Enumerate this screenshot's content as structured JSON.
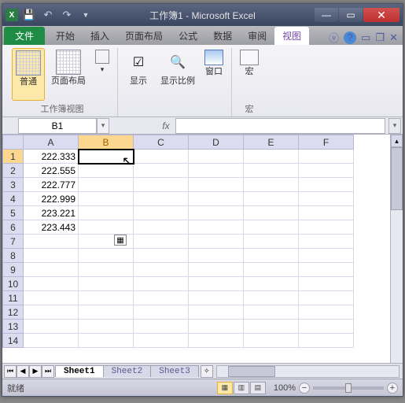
{
  "title": "工作簿1 - Microsoft Excel",
  "tabs": {
    "file": "文件",
    "items": [
      "开始",
      "插入",
      "页面布局",
      "公式",
      "数据",
      "审阅",
      "视图"
    ],
    "activeIndex": 6
  },
  "ribbon": {
    "group1": {
      "label": "工作簿视图",
      "btn_normal": "普通",
      "btn_page": "页面布局"
    },
    "group2": {
      "btn_show": "显示",
      "btn_zoom": "显示比例",
      "btn_window": "窗口"
    },
    "group3": {
      "label": "宏",
      "btn_macro": "宏"
    }
  },
  "namebox": "B1",
  "fx": "fx",
  "columns": [
    "A",
    "B",
    "C",
    "D",
    "E",
    "F"
  ],
  "rows": [
    "1",
    "2",
    "3",
    "4",
    "5",
    "6",
    "7",
    "8",
    "9",
    "10",
    "11",
    "12",
    "13",
    "14"
  ],
  "data": {
    "A1": "222.333",
    "A2": "222.555",
    "A3": "222.777",
    "A4": "222.999",
    "A5": "223.221",
    "A6": "223.443"
  },
  "selected": {
    "col": "B",
    "row": "1"
  },
  "sheets": [
    "Sheet1",
    "Sheet2",
    "Sheet3"
  ],
  "activeSheet": 0,
  "status": "就绪",
  "zoom": "100%",
  "chart_data": {
    "type": "table",
    "columns": [
      "A"
    ],
    "values": [
      222.333,
      222.555,
      222.777,
      222.999,
      223.221,
      223.443
    ]
  }
}
